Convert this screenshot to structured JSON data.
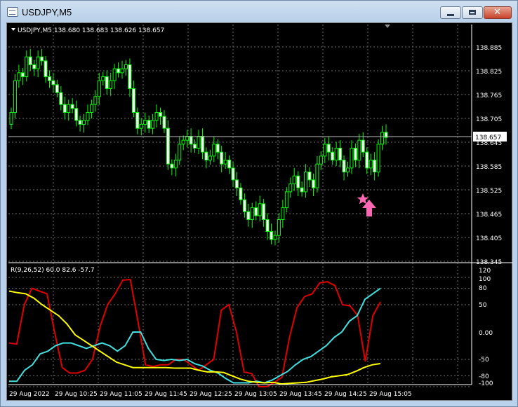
{
  "window": {
    "title": "USDJPY,M5",
    "icons": {
      "app": "chart-window-icon",
      "minimize": "minimize-icon",
      "maximize": "maximize-icon",
      "close": "close-icon"
    },
    "close_glyph": "✕"
  },
  "main_chart": {
    "header": "USDJPY,M5  138.680 138.683 138.626 138.657",
    "current_price": "138.657",
    "price_levels": [
      "138.885",
      "138.825",
      "138.765",
      "138.705",
      "138.645",
      "138.585",
      "138.525",
      "138.465",
      "138.405",
      "138.345"
    ],
    "markers": {
      "star": "star-icon",
      "arrow": "arrow-up-icon"
    },
    "colors": {
      "background": "#000000",
      "candles": "#00ff00",
      "grid": "#6e6e6e",
      "marker": "#ff69b4"
    }
  },
  "indicator": {
    "header": "R(9,26,52) 60.0 82.6 -57.7",
    "levels": [
      "120",
      "100",
      "80",
      "50",
      "0.00",
      "-50",
      "-80",
      "-100"
    ],
    "colors": {
      "red": "#e00000",
      "cyan": "#40e0e0",
      "yellow": "#ffff00"
    }
  },
  "time_axis": [
    "29 Aug 2022",
    "29 Aug 10:25",
    "29 Aug 11:05",
    "29 Aug 11:45",
    "29 Aug 12:25",
    "29 Aug 13:05",
    "29 Aug 13:45",
    "29 Aug 14:25",
    "29 Aug 15:05"
  ],
  "chart_data": [
    {
      "type": "candlestick",
      "title": "USDJPY,M5",
      "ohlc_header": [
        138.68,
        138.683,
        138.626,
        138.657
      ],
      "last_price": 138.657,
      "ylim": [
        138.345,
        138.915
      ],
      "ticks": [
        138.885,
        138.825,
        138.765,
        138.705,
        138.645,
        138.585,
        138.525,
        138.465,
        138.405,
        138.345
      ],
      "close_series": [
        138.72,
        138.8,
        138.82,
        138.81,
        138.86,
        138.84,
        138.83,
        138.86,
        138.85,
        138.81,
        138.8,
        138.79,
        138.77,
        138.74,
        138.72,
        138.74,
        138.73,
        138.7,
        138.69,
        138.7,
        138.72,
        138.74,
        138.76,
        138.8,
        138.81,
        138.78,
        138.8,
        138.83,
        138.82,
        138.83,
        138.84,
        138.78,
        138.72,
        138.68,
        138.69,
        138.7,
        138.68,
        138.7,
        138.72,
        138.71,
        138.68,
        138.59,
        138.58,
        138.6,
        138.64,
        138.65,
        138.66,
        138.64,
        138.63,
        138.66,
        138.62,
        138.6,
        138.61,
        138.64,
        138.62,
        138.59,
        138.6,
        138.58,
        138.55,
        138.53,
        138.5,
        138.47,
        138.45,
        138.48,
        138.46,
        138.49,
        138.45,
        138.42,
        138.4,
        138.41,
        138.45,
        138.48,
        138.52,
        138.54,
        138.56,
        138.53,
        138.52,
        138.57,
        138.55,
        138.53,
        138.59,
        138.61,
        138.64,
        138.62,
        138.6,
        138.63,
        138.6,
        138.57,
        138.58,
        138.63,
        138.6,
        138.65,
        138.62,
        138.58,
        138.6,
        138.57,
        138.64,
        138.67,
        138.657
      ]
    },
    {
      "type": "line",
      "title": "R(9,26,52)",
      "header_values": [
        60.0,
        82.6,
        -57.7
      ],
      "ylim": [
        -100,
        120
      ],
      "ticks": [
        120,
        100,
        80,
        50,
        0,
        -50,
        -80,
        -100
      ],
      "series": [
        {
          "name": "R(9)",
          "color": "#e00000",
          "values": [
            -20,
            -22,
            50,
            80,
            75,
            70,
            0,
            -65,
            -75,
            -75,
            -70,
            -50,
            10,
            50,
            70,
            95,
            96,
            20,
            -60,
            -63,
            -60,
            -60,
            -50,
            -50,
            -60,
            -70,
            -60,
            -50,
            40,
            50,
            0,
            -73,
            -76,
            -100,
            -100,
            -92,
            -83,
            -10,
            45,
            65,
            70,
            90,
            92,
            85,
            50,
            48,
            30,
            -54,
            30,
            55
          ]
        },
        {
          "name": "R(26)",
          "color": "#40e0e0",
          "values": [
            -90,
            -90,
            -70,
            -60,
            -40,
            -35,
            -25,
            -20,
            -20,
            -25,
            -30,
            -25,
            -20,
            -25,
            -35,
            -25,
            0,
            0,
            -30,
            -50,
            -52,
            -50,
            -52,
            -50,
            -58,
            -62,
            -70,
            -75,
            -85,
            -93,
            -93,
            -93,
            -90,
            -93,
            -88,
            -80,
            -72,
            -60,
            -50,
            -45,
            -35,
            -25,
            -10,
            0,
            20,
            30,
            60,
            70,
            80
          ]
        },
        {
          "name": "R(52)",
          "color": "#ffff00",
          "values": [
            75,
            72,
            70,
            62,
            50,
            40,
            30,
            15,
            -5,
            -15,
            -25,
            -35,
            -45,
            -55,
            -60,
            -65,
            -65,
            -65,
            -65,
            -65,
            -66,
            -66,
            -66,
            -70,
            -73,
            -73,
            -74,
            -80,
            -86,
            -90,
            -92,
            -93,
            -92,
            -95,
            -94,
            -93,
            -92,
            -89,
            -86,
            -82,
            -80,
            -78,
            -72,
            -65,
            -60,
            -57.7
          ]
        }
      ],
      "level_lines": [
        100,
        80,
        50,
        -50,
        -80,
        -100
      ]
    }
  ]
}
